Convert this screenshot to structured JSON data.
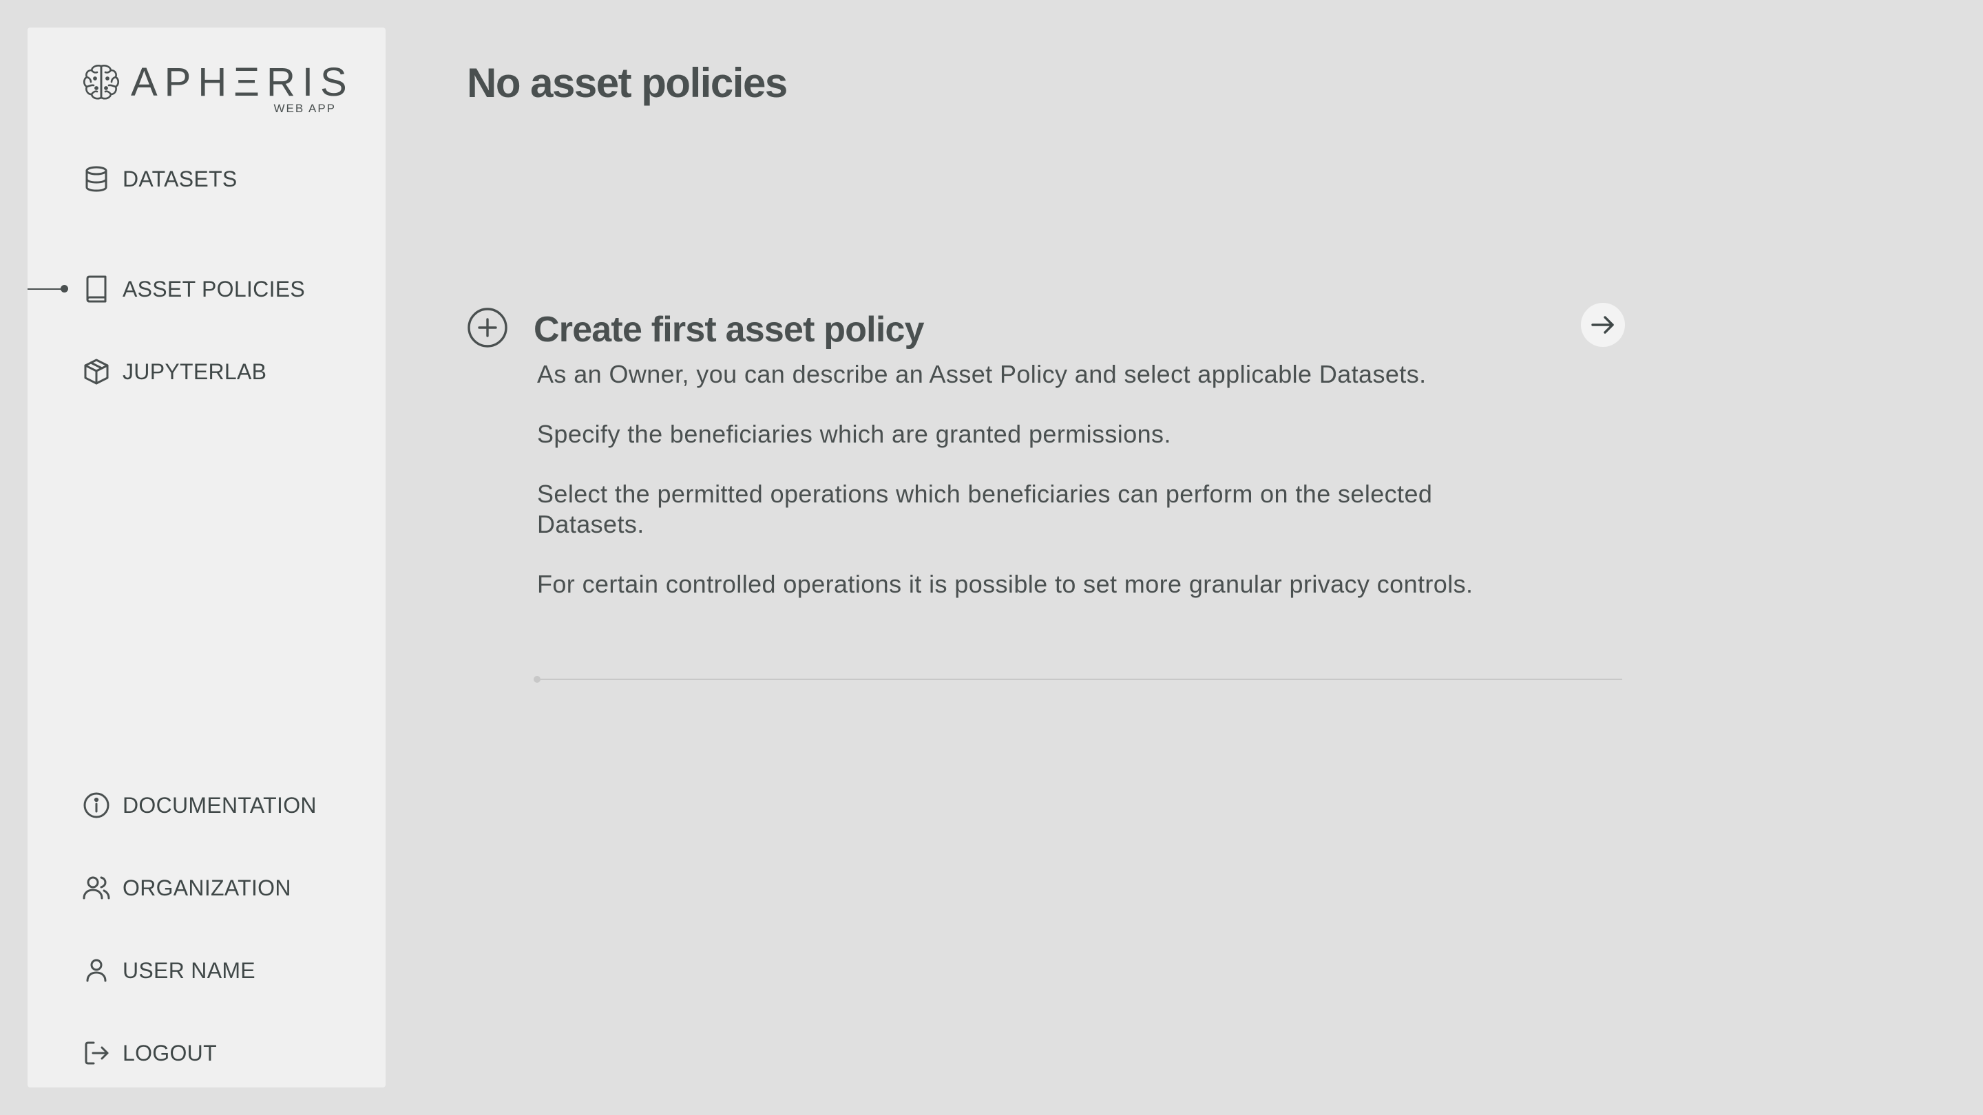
{
  "app": {
    "logo_text": "APHΞRIS",
    "logo_subtitle": "WEB APP"
  },
  "sidebar": {
    "top_items": [
      {
        "label": "DATASETS",
        "icon": "database-icon",
        "active": false
      },
      {
        "label": "ASSET POLICIES",
        "icon": "book-icon",
        "active": true
      },
      {
        "label": "JUPYTERLAB",
        "icon": "cube-icon",
        "active": false
      }
    ],
    "bottom_items": [
      {
        "label": "DOCUMENTATION",
        "icon": "info-icon"
      },
      {
        "label": "ORGANIZATION",
        "icon": "users-icon"
      },
      {
        "label": "USER NAME",
        "icon": "user-icon"
      },
      {
        "label": "LOGOUT",
        "icon": "logout-icon"
      }
    ]
  },
  "main": {
    "title": "No asset policies",
    "card": {
      "title": "Create first asset policy",
      "icon": "plus-circle-icon",
      "action_icon": "arrow-right-icon",
      "paragraphs": [
        "As an Owner, you can describe an Asset Policy and select applicable Datasets.",
        "Specify the beneficiaries which are granted permissions.",
        "Select the permitted operations which beneficiaries can perform on the selected Datasets.",
        "For certain controlled operations it is possible to set more granular privacy controls."
      ]
    }
  },
  "colors": {
    "background": "#e0e0e0",
    "sidebar": "#f0f0f0",
    "text": "#4a5050",
    "divider": "#c8c8c8"
  }
}
